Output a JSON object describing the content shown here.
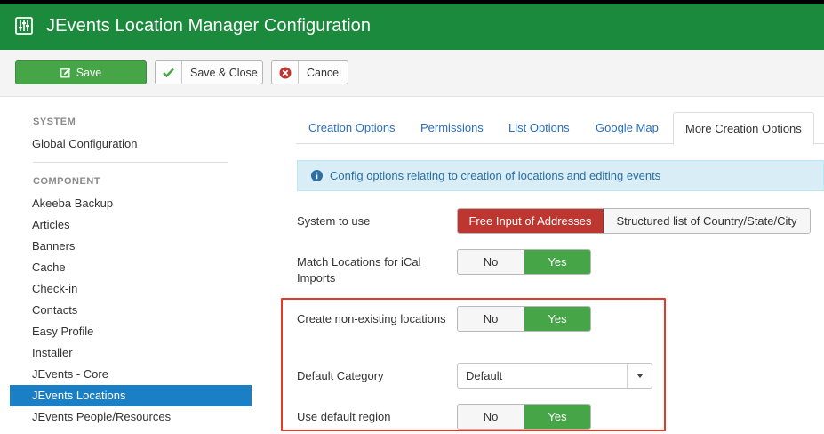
{
  "header": {
    "title": "JEvents Location Manager Configuration",
    "icon": "options-sliders-icon",
    "color": "#1c8a3c"
  },
  "toolbar": {
    "save_label": "Save",
    "save_close_label": "Save & Close",
    "cancel_label": "Cancel"
  },
  "sidebar": {
    "system_heading": "SYSTEM",
    "global_config": "Global Configuration",
    "component_heading": "COMPONENT",
    "items": [
      {
        "label": "Akeeba Backup"
      },
      {
        "label": "Articles"
      },
      {
        "label": "Banners"
      },
      {
        "label": "Cache"
      },
      {
        "label": "Check-in"
      },
      {
        "label": "Contacts"
      },
      {
        "label": "Easy Profile"
      },
      {
        "label": "Installer"
      },
      {
        "label": "JEvents - Core"
      },
      {
        "label": "JEvents Locations",
        "active": true
      },
      {
        "label": "JEvents People/Resources"
      }
    ]
  },
  "tabs": [
    {
      "label": "Creation Options"
    },
    {
      "label": "Permissions"
    },
    {
      "label": "List Options"
    },
    {
      "label": "Google Map"
    },
    {
      "label": "More Creation Options",
      "active": true
    }
  ],
  "info": {
    "text": "Config options relating to creation of locations and editing events"
  },
  "form": {
    "system_to_use": {
      "label": "System to use",
      "option_free": "Free Input of Addresses",
      "option_structured": "Structured list of Country/State/City",
      "selected": "Free Input of Addresses"
    },
    "match_locations": {
      "label": "Match Locations for iCal Imports",
      "no": "No",
      "yes": "Yes",
      "selected": "Yes"
    },
    "create_nonexisting": {
      "label": "Create non-existing locations",
      "no": "No",
      "yes": "Yes",
      "selected": "Yes"
    },
    "default_category": {
      "label": "Default Category",
      "value": "Default"
    },
    "use_default_region": {
      "label": "Use default region",
      "no": "No",
      "yes": "Yes",
      "selected": "Yes"
    }
  },
  "colors": {
    "accent_green": "#46a546",
    "active_blue": "#1a7fc4",
    "danger_red": "#bd362f",
    "highlight_red": "#e43a27",
    "info_bg": "#d9edf7"
  }
}
